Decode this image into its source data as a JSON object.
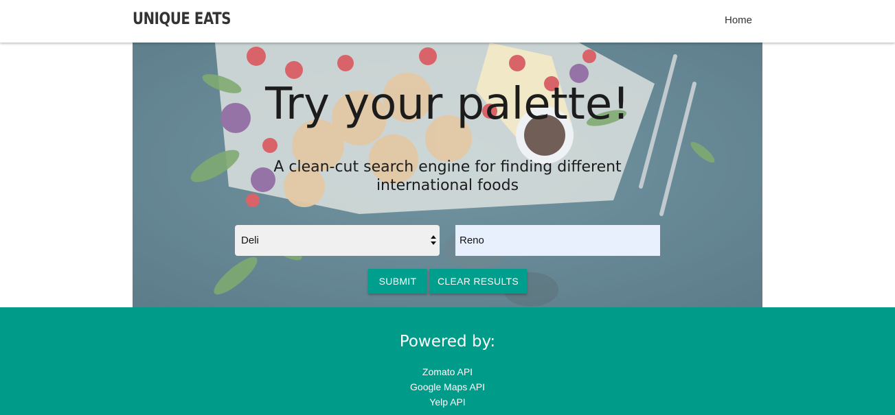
{
  "navbar": {
    "brand": "UNIQUE EATS",
    "links": [
      "Home"
    ]
  },
  "hero": {
    "title": "Try your palette!",
    "subtitle": "A clean-cut search engine for finding different international foods",
    "cuisine_select": {
      "selected": "Deli"
    },
    "location_input": {
      "value": "Reno"
    },
    "buttons": {
      "submit": "SUBMIT",
      "clear": "CLEAR RESULTS"
    }
  },
  "footer": {
    "title": "Powered by:",
    "items": [
      "Zomato API",
      "Google Maps API",
      "Yelp API"
    ]
  },
  "colors": {
    "accent": "#009b89",
    "button": "#009e8d",
    "input_autofill": "#e8f0fe"
  },
  "icons": {
    "select_arrows": "updown-arrows-icon"
  }
}
